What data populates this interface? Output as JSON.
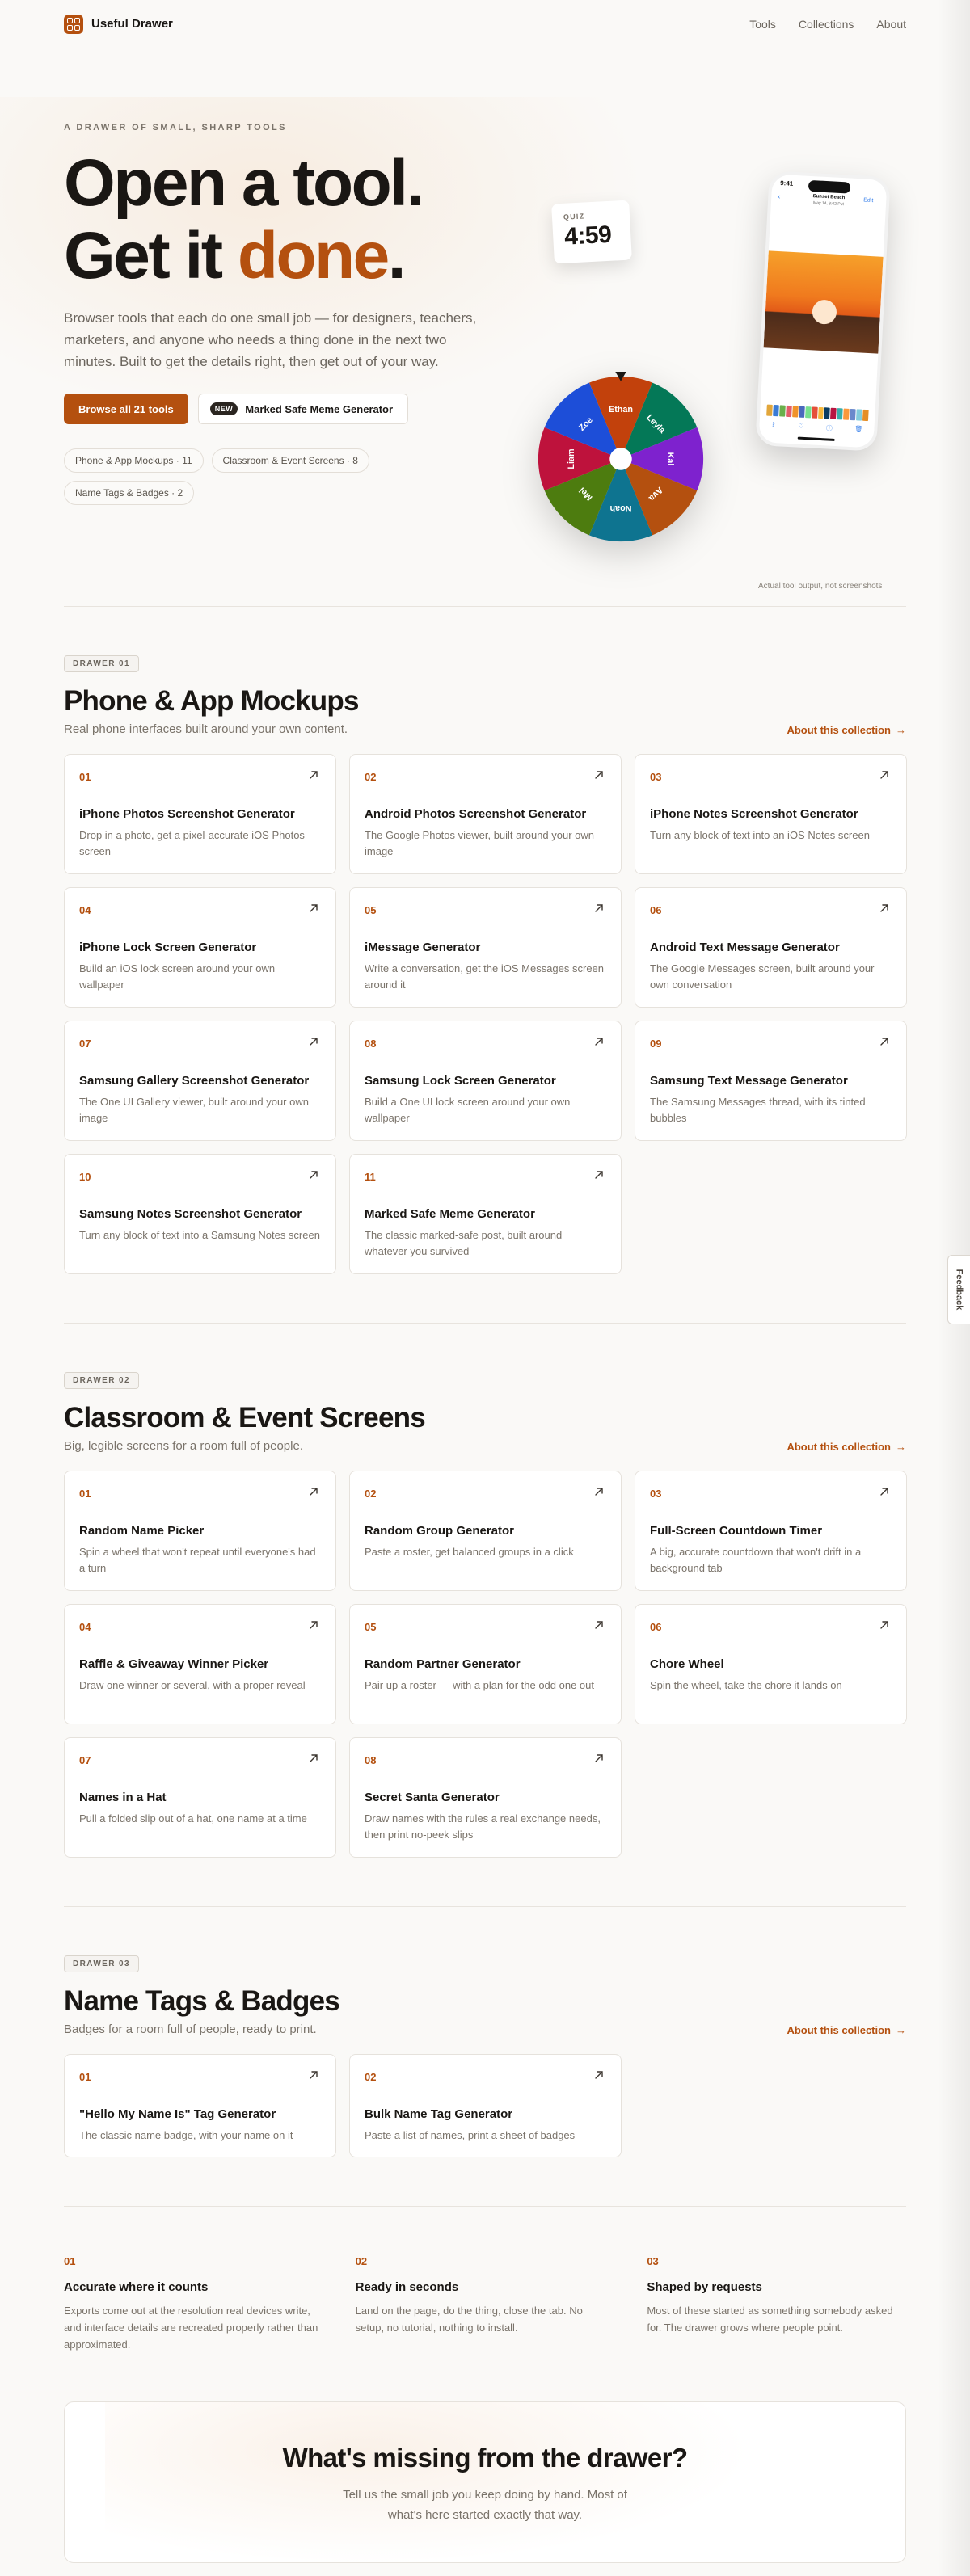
{
  "header": {
    "brand": "Useful Drawer",
    "nav": [
      "Tools",
      "Collections",
      "About"
    ]
  },
  "hero": {
    "eyebrow": "A DRAWER OF SMALL, SHARP TOOLS",
    "title_line1": "Open a tool.",
    "title_line2_start": "Get it ",
    "title_line2_accent": "done",
    "title_line2_end": ".",
    "description": "Browser tools that each do one small job — for designers, teachers, marketers, and anyone who needs a thing done in the next two minutes. Built to get the details right, then get out of your way.",
    "primary_button": "Browse all 21 tools",
    "new_badge": "NEW",
    "secondary_button": "Marked Safe Meme Generator",
    "pills": [
      "Phone & App Mockups · 11",
      "Classroom & Event Screens · 8",
      "Name Tags & Badges · 2"
    ],
    "quiz_label": "QUIZ",
    "quiz_time": "4:59",
    "wheel_names": [
      "Ethan",
      "Leyla",
      "Kai",
      "Ava",
      "Noah",
      "Mei",
      "Liam",
      "Zoe"
    ],
    "wheel_colors": [
      "#c2410c",
      "#047857",
      "#7e22ce",
      "#b4500f",
      "#0e7490",
      "#4d7c0f",
      "#be123c",
      "#1d4ed8"
    ],
    "phone_time": "9:41",
    "phone_title": "Sunset Beach",
    "phone_subtitle": "May 14, 8:02 PM",
    "phone_edit": "Edit",
    "caption": "Actual tool output, not screenshots",
    "accent_color": "#b4500f"
  },
  "collections": [
    {
      "tag": "DRAWER 01",
      "title": "Phone & App Mockups",
      "subtitle": "Real phone interfaces built around your own content.",
      "link": "About this collection",
      "tools": [
        {
          "num": "01",
          "title": "iPhone Photos Screenshot Generator",
          "desc": "Drop in a photo, get a pixel-accurate iOS Photos screen"
        },
        {
          "num": "02",
          "title": "Android Photos Screenshot Generator",
          "desc": "The Google Photos viewer, built around your own image"
        },
        {
          "num": "03",
          "title": "iPhone Notes Screenshot Generator",
          "desc": "Turn any block of text into an iOS Notes screen"
        },
        {
          "num": "04",
          "title": "iPhone Lock Screen Generator",
          "desc": "Build an iOS lock screen around your own wallpaper"
        },
        {
          "num": "05",
          "title": "iMessage Generator",
          "desc": "Write a conversation, get the iOS Messages screen around it"
        },
        {
          "num": "06",
          "title": "Android Text Message Generator",
          "desc": "The Google Messages screen, built around your own conversation"
        },
        {
          "num": "07",
          "title": "Samsung Gallery Screenshot Generator",
          "desc": "The One UI Gallery viewer, built around your own image"
        },
        {
          "num": "08",
          "title": "Samsung Lock Screen Generator",
          "desc": "Build a One UI lock screen around your own wallpaper"
        },
        {
          "num": "09",
          "title": "Samsung Text Message Generator",
          "desc": "The Samsung Messages thread, with its tinted bubbles"
        },
        {
          "num": "10",
          "title": "Samsung Notes Screenshot Generator",
          "desc": "Turn any block of text into a Samsung Notes screen"
        },
        {
          "num": "11",
          "title": "Marked Safe Meme Generator",
          "desc": "The classic marked-safe post, built around whatever you survived"
        }
      ]
    },
    {
      "tag": "DRAWER 02",
      "title": "Classroom & Event Screens",
      "subtitle": "Big, legible screens for a room full of people.",
      "link": "About this collection",
      "tools": [
        {
          "num": "01",
          "title": "Random Name Picker",
          "desc": "Spin a wheel that won't repeat until everyone's had a turn"
        },
        {
          "num": "02",
          "title": "Random Group Generator",
          "desc": "Paste a roster, get balanced groups in a click"
        },
        {
          "num": "03",
          "title": "Full-Screen Countdown Timer",
          "desc": "A big, accurate countdown that won't drift in a background tab"
        },
        {
          "num": "04",
          "title": "Raffle & Giveaway Winner Picker",
          "desc": "Draw one winner or several, with a proper reveal"
        },
        {
          "num": "05",
          "title": "Random Partner Generator",
          "desc": "Pair up a roster — with a plan for the odd one out"
        },
        {
          "num": "06",
          "title": "Chore Wheel",
          "desc": "Spin the wheel, take the chore it lands on"
        },
        {
          "num": "07",
          "title": "Names in a Hat",
          "desc": "Pull a folded slip out of a hat, one name at a time"
        },
        {
          "num": "08",
          "title": "Secret Santa Generator",
          "desc": "Draw names with the rules a real exchange needs, then print no-peek slips"
        }
      ]
    },
    {
      "tag": "DRAWER 03",
      "title": "Name Tags & Badges",
      "subtitle": "Badges for a room full of people, ready to print.",
      "link": "About this collection",
      "tools": [
        {
          "num": "01",
          "title": "\"Hello My Name Is\" Tag Generator",
          "desc": "The classic name badge, with your name on it"
        },
        {
          "num": "02",
          "title": "Bulk Name Tag Generator",
          "desc": "Paste a list of names, print a sheet of badges"
        }
      ]
    }
  ],
  "features": [
    {
      "num": "01",
      "title": "Accurate where it counts",
      "desc": "Exports come out at the resolution real devices write, and interface details are recreated properly rather than approximated."
    },
    {
      "num": "02",
      "title": "Ready in seconds",
      "desc": "Land on the page, do the thing, close the tab. No setup, no tutorial, nothing to install."
    },
    {
      "num": "03",
      "title": "Shaped by requests",
      "desc": "Most of these started as something somebody asked for. The drawer grows where people point."
    }
  ],
  "cta": {
    "title": "What's missing from the drawer?",
    "desc": "Tell us the small job you keep doing by hand. Most of what's here started exactly that way."
  },
  "feedback": "Feedback"
}
